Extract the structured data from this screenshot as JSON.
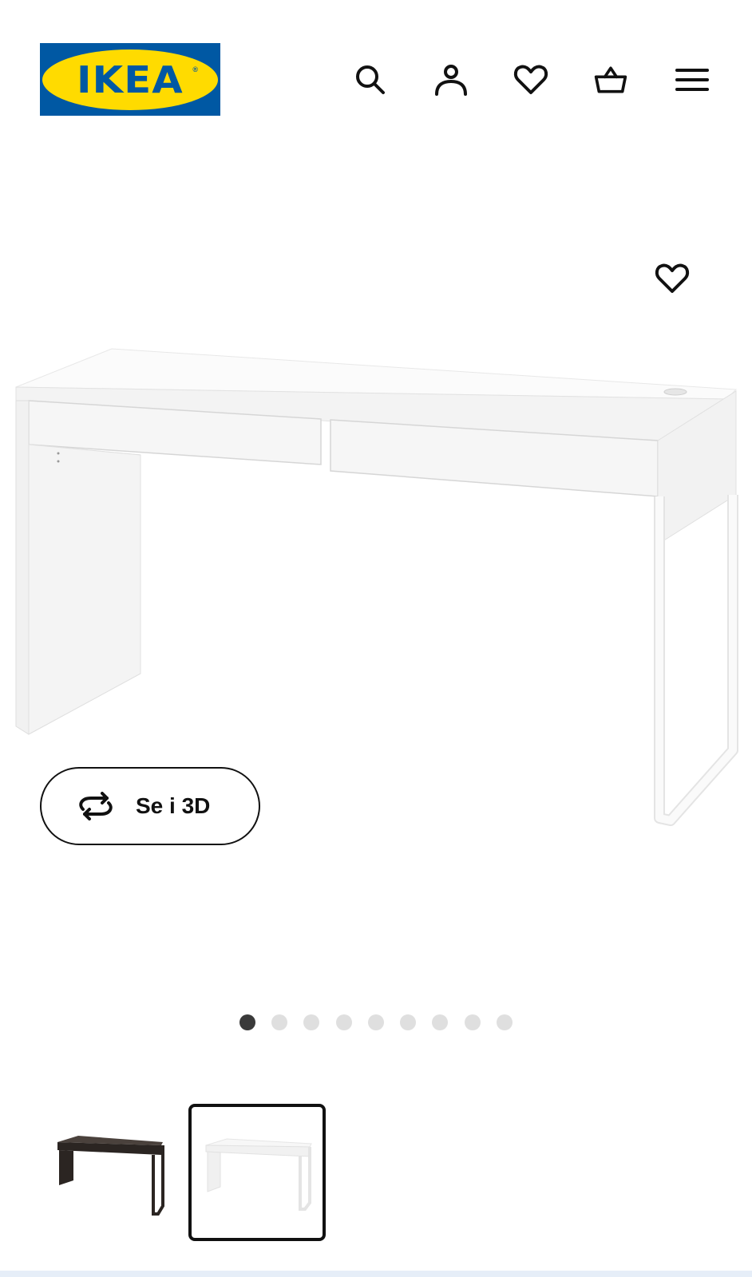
{
  "header": {
    "logo_text": "IKEA",
    "logo_colors": {
      "background": "#0058a3",
      "oval": "#ffdb00"
    },
    "icons": [
      "search-icon",
      "account-icon",
      "favourites-icon",
      "basket-icon",
      "menu-icon"
    ]
  },
  "gallery": {
    "favourite_icon": "heart-icon",
    "view_3d_label": "Se i 3D",
    "view_3d_icon": "rotate-360-icon",
    "dots_total": 9,
    "active_dot_index": 0
  },
  "variants": [
    {
      "color": "#2b2522",
      "selected": false
    },
    {
      "color": "#ffffff",
      "selected": true
    }
  ]
}
